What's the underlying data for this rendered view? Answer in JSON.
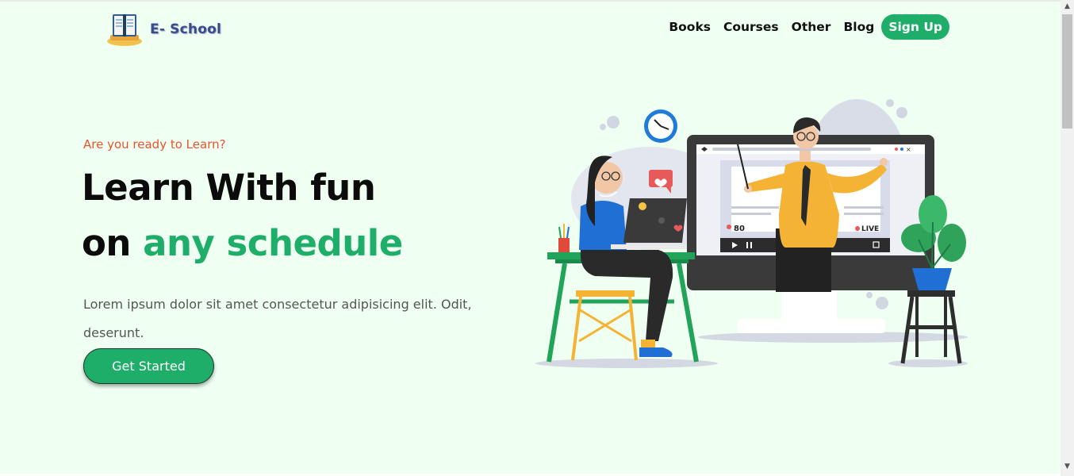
{
  "brand": {
    "name": "E- School",
    "logo_icon": "open-book-icon"
  },
  "nav": {
    "items": [
      "Books",
      "Courses",
      "Other",
      "Blog"
    ],
    "signup_label": "Sign Up"
  },
  "hero": {
    "eyebrow": "Are you ready to Learn?",
    "title_line1": "Learn With fun",
    "title_line2_prefix": "on",
    "title_line2_accent": "any schedule",
    "description": "Lorem ipsum dolor sit amet consectetur adipisicing elit. Odit, deserunt.",
    "cta_label": "Get Started"
  },
  "illustration": {
    "viewer_count": "80",
    "live_label": "LIVE"
  },
  "colors": {
    "accent": "#1fae6a",
    "eyebrow": "#e8532f",
    "background": "#effff2"
  }
}
